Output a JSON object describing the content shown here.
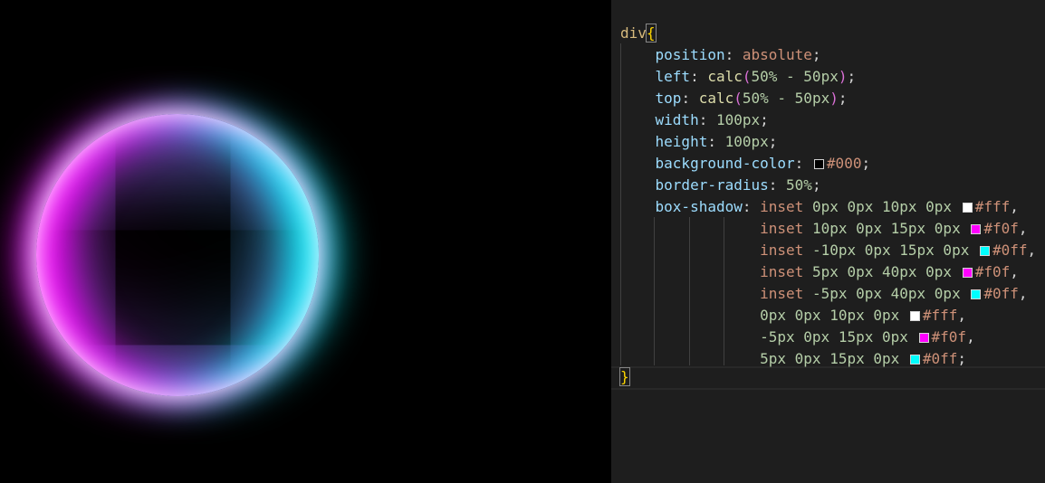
{
  "editor": {
    "selector": "div",
    "open_brace": "{",
    "close_brace": "}",
    "declarations": {
      "position": {
        "prop": "position",
        "value": "absolute"
      },
      "left": {
        "prop": "left",
        "fn": "calc",
        "args": "50% - 50px"
      },
      "top": {
        "prop": "top",
        "fn": "calc",
        "args": "50% - 50px"
      },
      "width": {
        "prop": "width",
        "value": "100px"
      },
      "height": {
        "prop": "height",
        "value": "100px"
      },
      "background_color": {
        "prop": "background-color",
        "value": "#000",
        "swatch": "#000000"
      },
      "border_radius": {
        "prop": "border-radius",
        "value": "50%"
      },
      "box_shadow_prop": "box-shadow"
    },
    "shadows": [
      {
        "inset": "inset",
        "offsets": "0px 0px 10px 0px",
        "color": "#fff",
        "swatch": "#ffffff",
        "sep": ","
      },
      {
        "inset": "inset",
        "offsets": "10px 0px 15px 0px",
        "color": "#f0f",
        "swatch": "#ff00ff",
        "sep": ","
      },
      {
        "inset": "inset",
        "offsets": "-10px 0px 15px 0px",
        "color": "#0ff",
        "swatch": "#00ffff",
        "sep": ","
      },
      {
        "inset": "inset",
        "offsets": "5px 0px 40px 0px",
        "color": "#f0f",
        "swatch": "#ff00ff",
        "sep": ","
      },
      {
        "inset": "inset",
        "offsets": "-5px 0px 40px 0px",
        "color": "#0ff",
        "swatch": "#00ffff",
        "sep": ","
      },
      {
        "inset": "",
        "offsets": "0px 0px 10px 0px",
        "color": "#fff",
        "swatch": "#ffffff",
        "sep": ","
      },
      {
        "inset": "",
        "offsets": "-5px 0px 15px 0px",
        "color": "#f0f",
        "swatch": "#ff00ff",
        "sep": ","
      },
      {
        "inset": "",
        "offsets": "5px 0px 15px 0px",
        "color": "#0ff",
        "swatch": "#00ffff",
        "sep": ";"
      }
    ]
  },
  "colors": {
    "editor_bg": "#1e1e1e",
    "preview_bg": "#000000",
    "magenta": "#ff00ff",
    "cyan": "#00ffff",
    "white": "#ffffff"
  }
}
